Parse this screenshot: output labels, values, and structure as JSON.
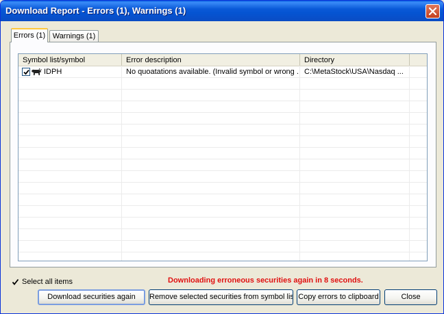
{
  "window": {
    "title": "Download Report - Errors (1), Warnings (1)"
  },
  "tabs": [
    {
      "label": "Errors (1)",
      "active": true
    },
    {
      "label": "Warnings (1)",
      "active": false
    }
  ],
  "list": {
    "columns": [
      "Symbol list/symbol",
      "Error description",
      "Directory"
    ],
    "rows": [
      {
        "checked": true,
        "icon": "bull-icon",
        "symbol": "IDPH",
        "error": "No quoatations available. (Invalid symbol or wrong ...",
        "directory": "C:\\MetaStock\\USA\\Nasdaq ..."
      }
    ]
  },
  "select_all": {
    "label": "Select all items",
    "checked": true
  },
  "status_text": "Downloading erroneous securities again in 8 seconds.",
  "status_color": "#e01010",
  "buttons": {
    "download_again": "Download securities again",
    "remove_selected": "Remove selected securities from symbol list",
    "copy_errors": "Copy errors to clipboard",
    "close": "Close"
  },
  "colors": {
    "title_bar": "#0554d2",
    "dialog_bg": "#ece9d8",
    "close_button": "#c4401e"
  }
}
